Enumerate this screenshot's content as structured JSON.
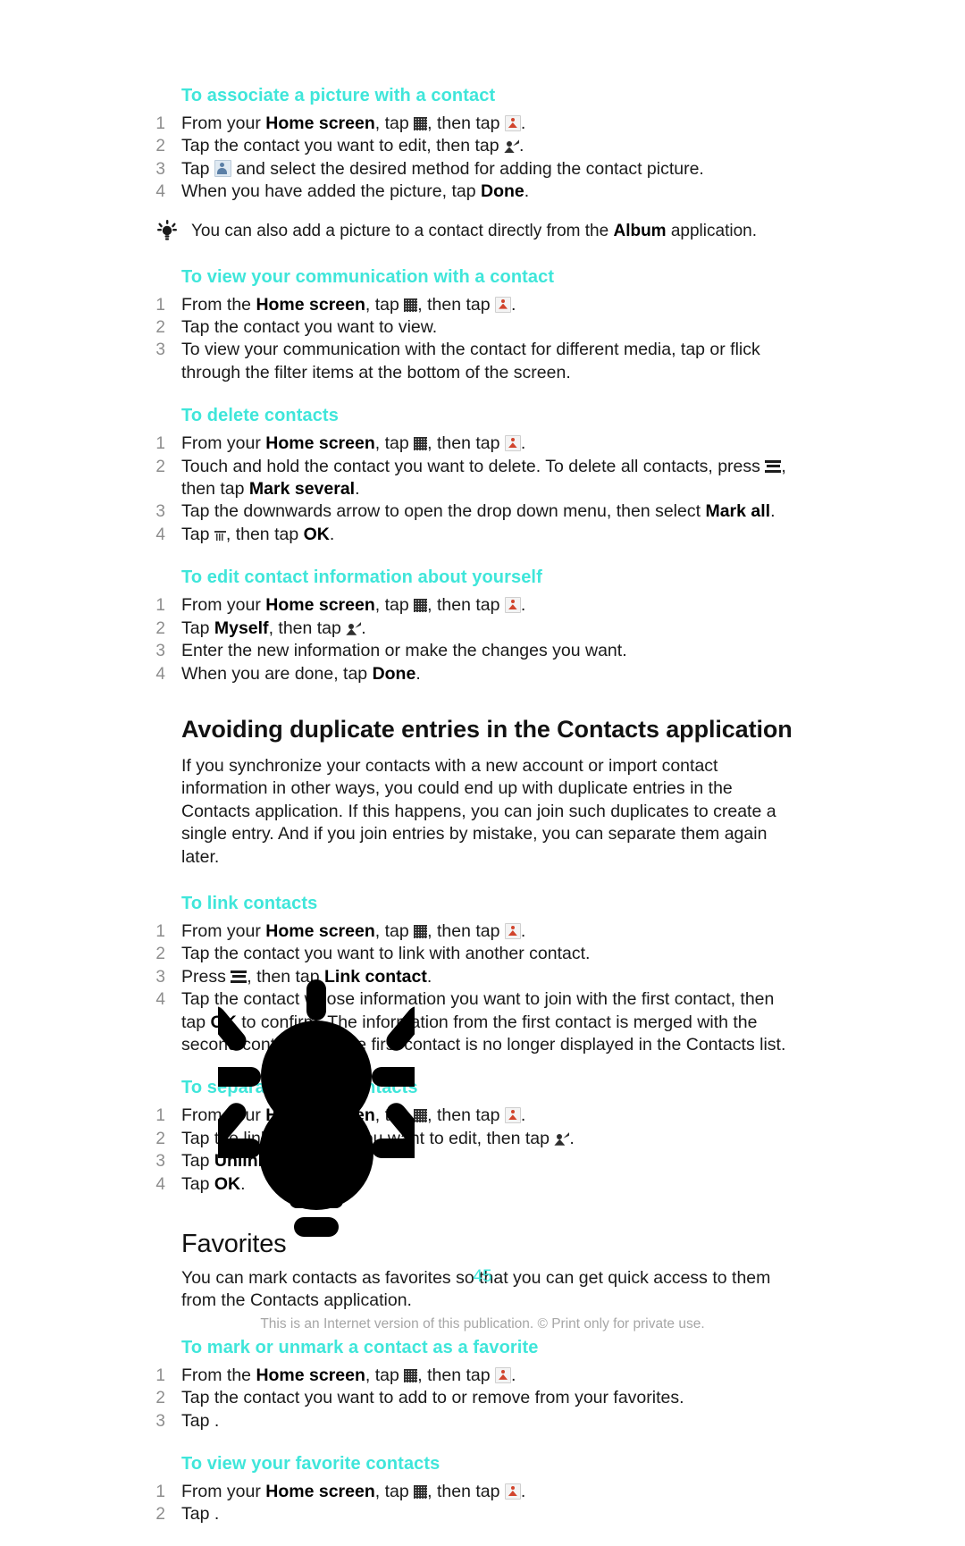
{
  "document": {
    "page_number": "45",
    "footer_note": "This is an Internet version of this publication. © Print only for private use.",
    "heading_color": "#3FE6DA"
  },
  "sections": [
    {
      "id": "associate-picture",
      "heading": "To associate a picture with a contact",
      "steps": [
        {
          "num": "1",
          "text": "From your Home screen, tap [appgrid], then tap [contacts]."
        },
        {
          "num": "2",
          "text": "Tap the contact you want to edit, then tap [editcontact]."
        },
        {
          "num": "3",
          "text": "Tap [avatar] and select the desired method for adding the contact picture."
        },
        {
          "num": "4",
          "text": "When you have added the picture, tap Done."
        }
      ],
      "tip": "You can also add a picture to a contact directly from the Album application."
    },
    {
      "id": "view-communication",
      "heading": "To view your communication with a contact",
      "steps": [
        {
          "num": "1",
          "text": "From the Home screen, tap [appgrid], then tap [contacts]."
        },
        {
          "num": "2",
          "text": "Tap the contact you want to view."
        },
        {
          "num": "3",
          "text": "To view your communication with the contact for different media, tap or flick through the filter items at the bottom of the screen."
        }
      ]
    },
    {
      "id": "delete-contacts",
      "heading": "To delete contacts",
      "steps": [
        {
          "num": "1",
          "text": "From your Home screen, tap [appgrid], then tap [contacts]."
        },
        {
          "num": "2",
          "text": "Touch and hold the contact you want to delete. To delete all contacts, press [menu], then tap Mark several."
        },
        {
          "num": "3",
          "text": "Tap the downwards arrow to open the drop down menu, then select Mark all."
        },
        {
          "num": "4",
          "text": "Tap [trash], then tap OK."
        }
      ]
    },
    {
      "id": "edit-myself",
      "heading": "To edit contact information about yourself",
      "steps": [
        {
          "num": "1",
          "text": "From your Home screen, tap [appgrid], then tap [contacts]."
        },
        {
          "num": "2",
          "text": "Tap Myself, then tap [editcontact]."
        },
        {
          "num": "3",
          "text": "Enter the new information or make the changes you want."
        },
        {
          "num": "4",
          "text": "When you are done, tap Done."
        }
      ]
    }
  ],
  "avoiding_duplicates": {
    "heading": "Avoiding duplicate entries in the Contacts application",
    "body": "If you synchronize your contacts with a new account or import contact information in other ways, you could end up with duplicate entries in the Contacts application. If this happens, you can join such duplicates to create a single entry. And if you join entries by mistake, you can separate them again later.",
    "sections": [
      {
        "id": "link-contacts",
        "heading": "To link contacts",
        "steps": [
          {
            "num": "1",
            "text": "From your Home screen, tap [appgrid], then tap [contacts]."
          },
          {
            "num": "2",
            "text": "Tap the contact you want to link with another contact."
          },
          {
            "num": "3",
            "text": "Press [menu], then tap Link contact."
          },
          {
            "num": "4",
            "text": "Tap the contact whose information you want to join with the first contact, then tap OK to confirm. The information from the first contact is merged with the second contact, and the first contact is no longer displayed in the Contacts list."
          }
        ]
      },
      {
        "id": "separate-linked",
        "heading": "To separate linked contacts",
        "steps": [
          {
            "num": "1",
            "text": "From your Home screen, tap [appgrid], then tap [contacts]."
          },
          {
            "num": "2",
            "text": "Tap the linked contact you want to edit, then tap [editcontact]."
          },
          {
            "num": "3",
            "text": "Tap Unlink contact."
          },
          {
            "num": "4",
            "text": "Tap OK."
          }
        ]
      }
    ]
  },
  "favorites": {
    "heading": "Favorites",
    "body": "You can mark contacts as favorites so that you can get quick access to them from the Contacts application.",
    "sections": [
      {
        "id": "mark-unmark-favorite",
        "heading": "To mark or unmark a contact as a favorite",
        "steps": [
          {
            "num": "1",
            "text": "From the Home screen, tap [appgrid], then tap [contacts]."
          },
          {
            "num": "2",
            "text": "Tap the contact you want to add to or remove from your favorites."
          },
          {
            "num": "3",
            "text": "Tap ."
          }
        ]
      },
      {
        "id": "view-favorite-contacts",
        "heading": "To view your favorite contacts",
        "steps": [
          {
            "num": "1",
            "text": "From your Home screen, tap [appgrid], then tap [contacts]."
          },
          {
            "num": "2",
            "text": "Tap ."
          }
        ]
      }
    ]
  },
  "overlay": {
    "icon": "lightbulb-tip-icon",
    "color": "#000000"
  }
}
